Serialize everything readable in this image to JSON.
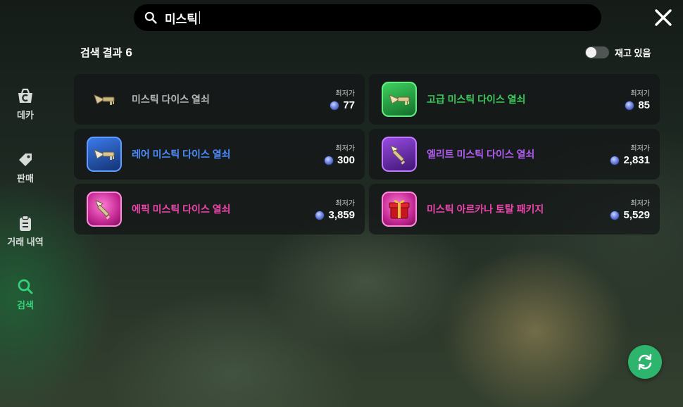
{
  "search": {
    "query": "미스틱"
  },
  "results": {
    "label": "검색 결과",
    "count": "6",
    "stock_filter_label": "재고 있음"
  },
  "sidebar": {
    "items": [
      {
        "label": "데카",
        "icon": "deka-basket-icon"
      },
      {
        "label": "판매",
        "icon": "tag-icon"
      },
      {
        "label": "거래 내역",
        "icon": "clipboard-icon"
      },
      {
        "label": "검색",
        "icon": "search-icon"
      }
    ],
    "active": "검색"
  },
  "price_label": "최저가",
  "items": [
    {
      "name": "미스틱 다이스 열쇠",
      "price_label": "최저가",
      "price": "77",
      "rarity": "normal",
      "color": "#b5b9b7"
    },
    {
      "name": "고급 미스틱 다이스 열쇠",
      "price_label": "최저기",
      "price": "85",
      "rarity": "uncommon",
      "color": "#3dc95d"
    },
    {
      "name": "레어 미스틱 다이스 열쇠",
      "price_label": "최저가",
      "price": "300",
      "rarity": "rare",
      "color": "#4d8dff"
    },
    {
      "name": "엘리트 미스틱 다이스 열쇠",
      "price_label": "최저가",
      "price": "2,831",
      "rarity": "elite",
      "color": "#b15cf2"
    },
    {
      "name": "에픽 미스틱 다이스 열쇠",
      "price_label": "최저가",
      "price": "3,859",
      "rarity": "epic",
      "color": "#ef45ad"
    },
    {
      "name": "미스틱 아르카나 토탈 패키지",
      "price_label": "최저가",
      "price": "5,529",
      "rarity": "epic",
      "color": "#ef45ad"
    }
  ],
  "colors": {
    "accent_green": "#2db46d",
    "active_nav": "#33d17a"
  }
}
